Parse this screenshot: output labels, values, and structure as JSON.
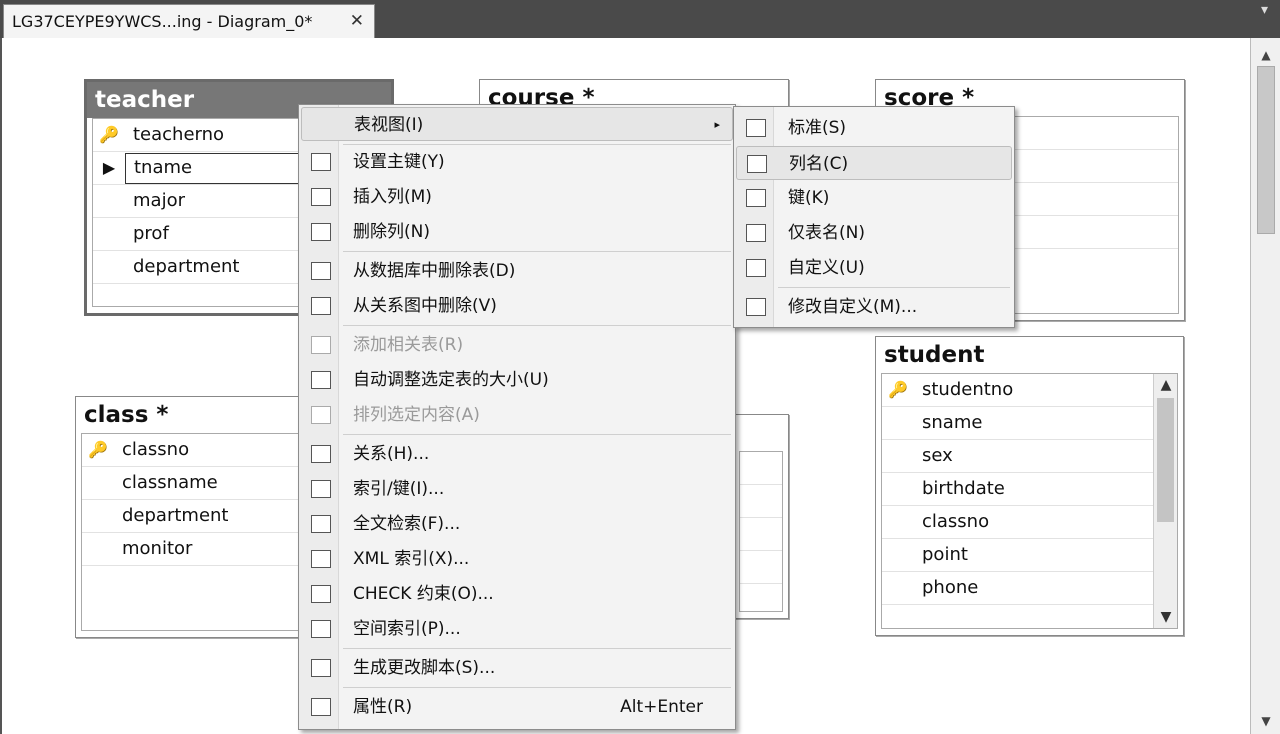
{
  "tab": {
    "title": "LG37CEYPE9YWCS...ing - Diagram_0*",
    "close": "✕",
    "dropdown": "▾"
  },
  "scroll": {
    "up": "▲",
    "down": "▼"
  },
  "tables": {
    "teacher": {
      "title": "teacher",
      "rows": [
        "teacherno",
        "tname",
        "major",
        "prof",
        "department"
      ]
    },
    "course": {
      "title": "course *"
    },
    "score": {
      "title": "score *"
    },
    "class": {
      "title": "class *",
      "rows": [
        "classno",
        "classname",
        "department",
        "monitor"
      ]
    },
    "student": {
      "title": "student",
      "rows": [
        "studentno",
        "sname",
        "sex",
        "birthdate",
        "classno",
        "point",
        "phone"
      ]
    }
  },
  "row_glyphs": {
    "key": "🔑",
    "current": "▶"
  },
  "context_menu": {
    "table_view": "表视图(I)",
    "set_primary_key": "设置主键(Y)",
    "insert_column": "插入列(M)",
    "delete_column": "删除列(N)",
    "delete_from_db": "从数据库中删除表(D)",
    "remove_from_diagram": "从关系图中删除(V)",
    "add_related_tables": "添加相关表(R)",
    "autosize_tables": "自动调整选定表的大小(U)",
    "arrange_selection": "排列选定内容(A)",
    "relationships": "关系(H)...",
    "indexes_keys": "索引/键(I)...",
    "fulltext_index": "全文检索(F)...",
    "xml_index": "XML 索引(X)...",
    "check_constraints": "CHECK 约束(O)...",
    "spatial_index": "空间索引(P)...",
    "generate_script": "生成更改脚本(S)...",
    "properties": "属性(R)",
    "properties_shortcut": "Alt+Enter",
    "submenu_arrow": "▸"
  },
  "submenu": {
    "standard": "标准(S)",
    "column_names": "列名(C)",
    "keys": "键(K)",
    "name_only": "仅表名(N)",
    "custom": "自定义(U)",
    "modify_custom": "修改自定义(M)..."
  }
}
